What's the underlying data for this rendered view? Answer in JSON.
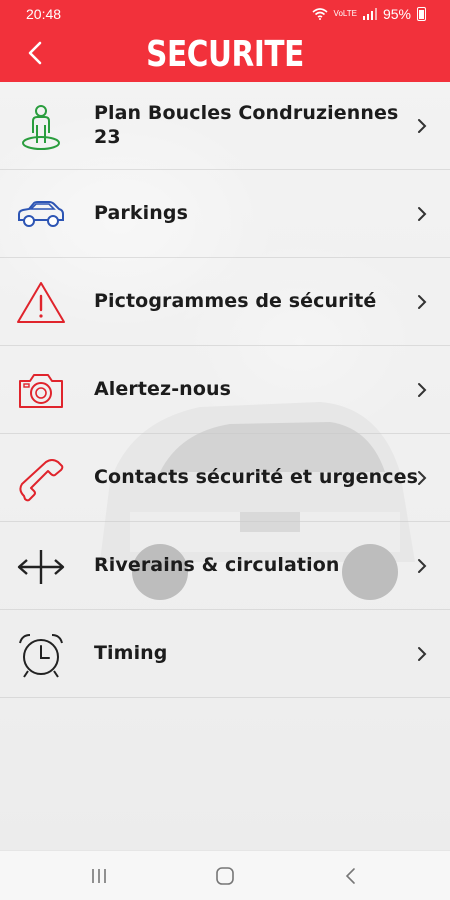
{
  "status_bar": {
    "time": "20:48",
    "network": "VoLTE",
    "battery": "95%"
  },
  "header": {
    "title": "SECURITE",
    "back_icon": "back-arrow-icon",
    "accent_color": "#f2313b"
  },
  "menu": {
    "items": [
      {
        "label": "Plan Boucles Condruziennes 23",
        "icon": "person-on-map-icon",
        "icon_color": "#2a9d3e"
      },
      {
        "label": "Parkings",
        "icon": "car-icon",
        "icon_color": "#2d55b4"
      },
      {
        "label": "Pictogrammes de sécurité",
        "icon": "warning-triangle-icon",
        "icon_color": "#e0242c"
      },
      {
        "label": "Alertez-nous",
        "icon": "camera-icon",
        "icon_color": "#e0242c"
      },
      {
        "label": "Contacts sécurité et urgences",
        "icon": "phone-icon",
        "icon_color": "#e0242c"
      },
      {
        "label": "Riverains & circulation",
        "icon": "crossroads-arrows-icon",
        "icon_color": "#222222"
      },
      {
        "label": "Timing",
        "icon": "alarm-clock-icon",
        "icon_color": "#222222"
      }
    ]
  },
  "navigation_bar": {
    "recent_icon": "recent-apps-icon",
    "home_icon": "home-icon",
    "back_icon": "nav-back-icon"
  }
}
